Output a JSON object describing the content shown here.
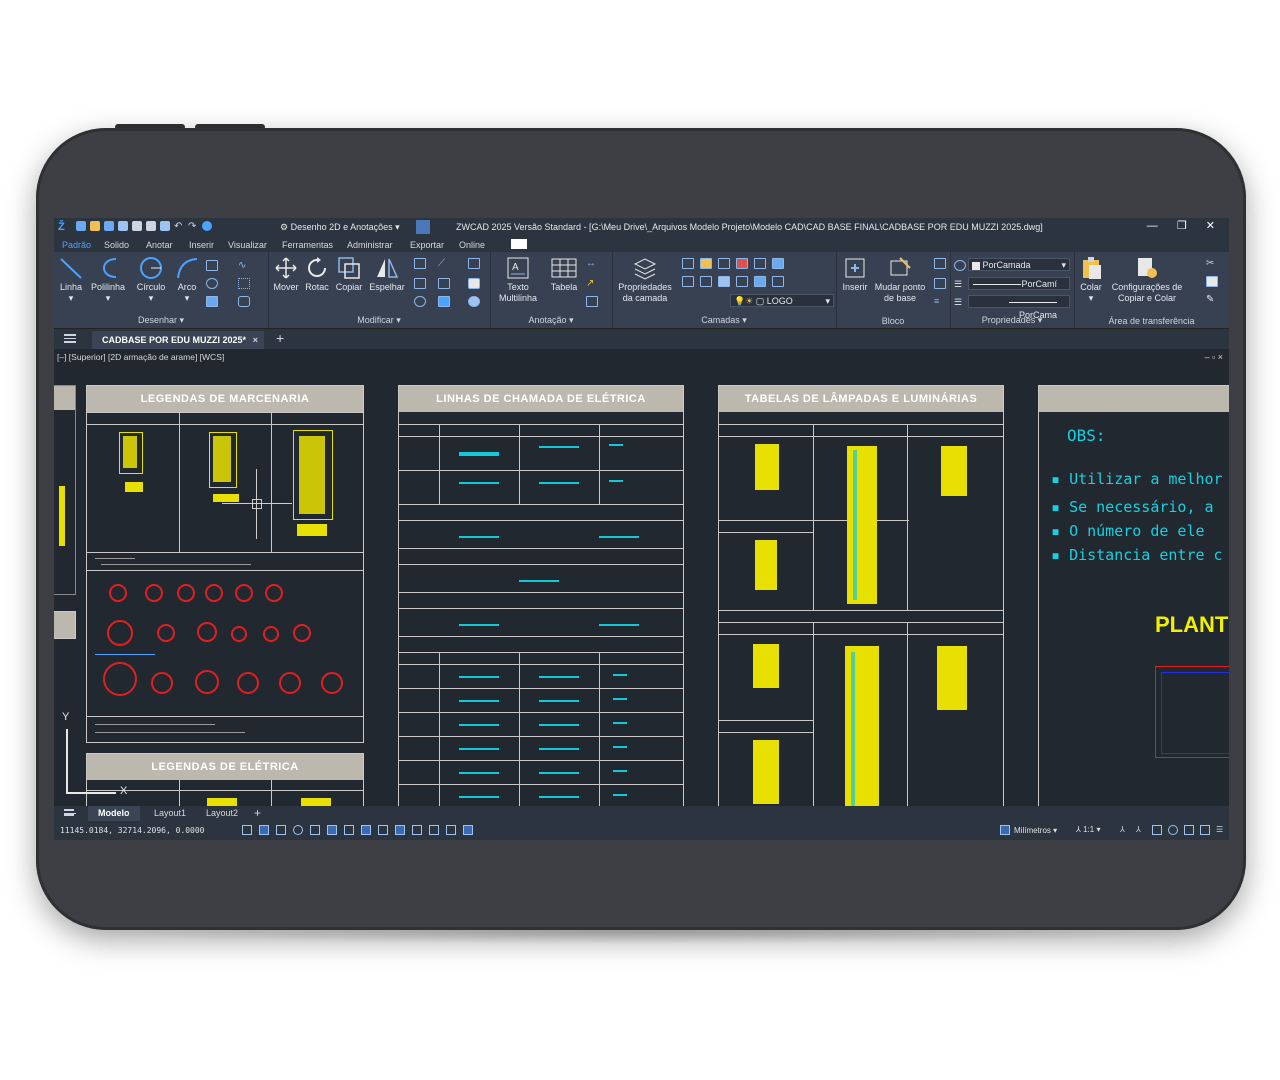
{
  "app": {
    "title": "ZWCAD 2025 Versão Standard - [G:\\Meu Drive\\_Arquivos Modelo Projeto\\Modelo CAD\\CAD BASE FINAL\\CADBASE POR EDU MUZZI 2025.dwg]",
    "workspace": "Desenho 2D e Anotações",
    "window_controls": "— ❐ ✕"
  },
  "menu": [
    "Padrão",
    "Solido",
    "Anotar",
    "Inserir",
    "Visualizar",
    "Ferramentas",
    "Administrar",
    "Exportar",
    "Online"
  ],
  "ribbon": {
    "desenhar": {
      "title": "Desenhar ▾",
      "tools": [
        "Linha",
        "Polilinha",
        "Círculo",
        "Arco"
      ]
    },
    "modificar": {
      "title": "Modificar ▾",
      "tools": [
        "Mover",
        "Rotac",
        "Copiar",
        "Espelhar"
      ]
    },
    "anotacao": {
      "title": "Anotação ▾",
      "tools": [
        "Texto\nMultilinha",
        "Tabela"
      ]
    },
    "camadas": {
      "title": "Camadas ▾",
      "tools": [
        "Propriedades\nda camada"
      ],
      "layer": "LOGO"
    },
    "bloco": {
      "title": "Bloco",
      "tools": [
        "Inserir",
        "Mudar ponto\nde base"
      ]
    },
    "propriedades": {
      "title": "Propriedades ▾",
      "combos": [
        "PorCamada",
        "PorCamí",
        "PorCama"
      ]
    },
    "transferencia": {
      "title": "Área de transferência",
      "tools": [
        "Colar",
        "Configurações de\nCopiar e Colar"
      ]
    }
  },
  "doc_tab": "CADBASE POR EDU MUZZI 2025*",
  "viewport": {
    "label": "[–] [Superior] [2D armação de arame] [WCS]",
    "controls": "– ▫ ×",
    "axis_x": "X",
    "axis_y": "Y"
  },
  "sheets": {
    "marcenaria": "LEGENDAS DE MARCENARIA",
    "eletrica_legendas": "LEGENDAS DE ELÉTRICA",
    "linhas_chamada": "LINHAS DE CHAMADA DE ELÉTRICA",
    "lampadas": "TABELAS DE LÂMPADAS E LUMINÁRIAS"
  },
  "obs": {
    "title": "OBS:",
    "items": [
      "Utilizar a melhor",
      "Se necessário, a",
      "O número de ele",
      "Distancia entre c"
    ],
    "plan": "PLANT"
  },
  "layout_tabs": [
    "Modelo",
    "Layout1",
    "Layout2"
  ],
  "status": {
    "coords": "11145.0184, 32714.2096, 0.0000",
    "units": "Milímetros",
    "scale": "1:1"
  }
}
